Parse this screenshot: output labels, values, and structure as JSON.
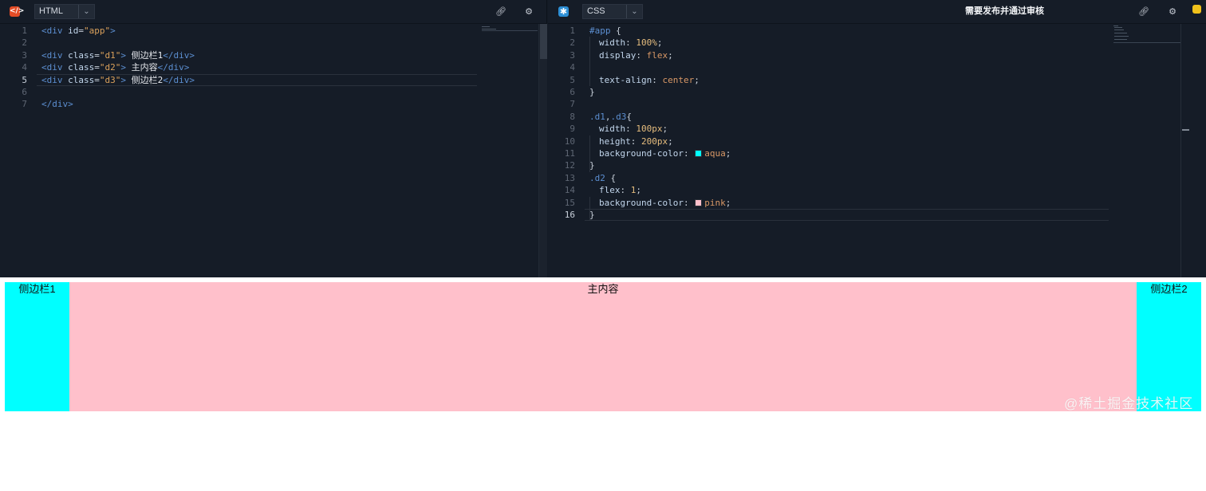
{
  "html_pane": {
    "icon": "html-code-icon",
    "lang_select": "HTML",
    "line_numbers": [
      "1",
      "2",
      "3",
      "4",
      "5",
      "6",
      "7"
    ],
    "active_line": "5",
    "lines": {
      "l1": {
        "a": "<div ",
        "b": "id",
        "c": "=",
        "d": "\"app\"",
        "e": ">"
      },
      "l3": {
        "a": "<div ",
        "b": "class",
        "c": "=",
        "d": "\"d1\"",
        "e": ">",
        "f": " 侧边栏1",
        "g": "</div>"
      },
      "l4": {
        "a": "<div ",
        "b": "class",
        "c": "=",
        "d": "\"d2\"",
        "e": ">",
        "f": " 主内容",
        "g": "</div>"
      },
      "l5": {
        "a": "<div ",
        "b": "class",
        "c": "=",
        "d": "\"d3\"",
        "e": ">",
        "f": " 侧边栏2",
        "g": "</div>"
      },
      "l7": {
        "a": "</div>"
      }
    }
  },
  "css_pane": {
    "icon": "css-asterisk-icon",
    "lang_select": "CSS",
    "notice": "需要发布并通过审核",
    "line_numbers": [
      "1",
      "2",
      "3",
      "4",
      "5",
      "6",
      "7",
      "8",
      "9",
      "10",
      "11",
      "12",
      "13",
      "14",
      "15",
      "16"
    ],
    "active_line": "16",
    "lines": {
      "l1": {
        "sel": "#app",
        "p": " {"
      },
      "l2": {
        "prop": "width",
        "c": ": ",
        "v": "100%",
        ";": ";"
      },
      "l3": {
        "prop": "display",
        "c": ": ",
        "v": "flex",
        ";": ";"
      },
      "l5": {
        "prop": "text-align",
        "c": ": ",
        "v": "center",
        ";": ";"
      },
      "l6": {
        "p": "}"
      },
      "l8": {
        "sel": ".d1",
        ",": ",",
        "sel2": ".d3",
        "p": "{"
      },
      "l9": {
        "prop": "width",
        "c": ": ",
        "v": "100px",
        ";": ";"
      },
      "l10": {
        "prop": "height",
        "c": ": ",
        "v": "200px",
        ";": ";"
      },
      "l11": {
        "prop": "background-color",
        "c": ": ",
        "v": "aqua",
        ";": ";"
      },
      "l12": {
        "p": "}"
      },
      "l13": {
        "sel": ".d2",
        "p": " {"
      },
      "l14": {
        "prop": "flex",
        "c": ": ",
        "v": "1",
        ";": ";"
      },
      "l15": {
        "prop": "background-color",
        "c": ": ",
        "v": "pink",
        ";": ";"
      },
      "l16": {
        "p": "}"
      }
    }
  },
  "toolbar_icons": {
    "link": "link-icon",
    "settings": "gear-icon",
    "warning": "warning-icon"
  },
  "preview": {
    "sidebar1": "侧边栏1",
    "main": "主内容",
    "sidebar2": "侧边栏2"
  },
  "colors": {
    "aqua": "#00ffff",
    "pink": "#ffc0cb",
    "editor_bg": "#151c27"
  },
  "watermark": "@稀土掘金技术社区"
}
